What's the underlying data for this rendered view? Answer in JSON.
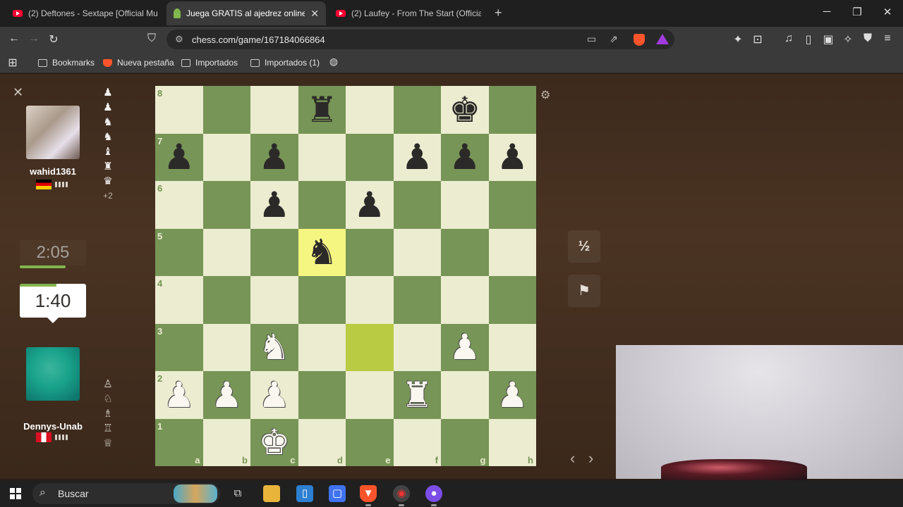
{
  "browser": {
    "tabs": [
      {
        "title": "(2) Deftones - Sextape [Official Music",
        "icon": "youtube-icon",
        "active": false
      },
      {
        "title": "Juega GRATIS al ajedrez online -",
        "icon": "chess-pawn-icon",
        "active": true
      },
      {
        "title": "(2) Laufey - From The Start (Official M",
        "icon": "youtube-icon",
        "active": false
      }
    ],
    "url": "chess.com/game/167184066864",
    "bookmarks": [
      {
        "label": "Bookmarks",
        "icon": "bookmarks-icon"
      },
      {
        "label": "Nueva pestaña",
        "icon": "brave-icon"
      },
      {
        "label": "Importados",
        "icon": "folder-icon"
      },
      {
        "label": "Importados (1)",
        "icon": "folder-icon"
      }
    ]
  },
  "game": {
    "top_player": {
      "name": "wahid1361",
      "country": "Germany",
      "clock": "2:05",
      "captured": [
        "♟",
        "♟",
        "♞",
        "♞",
        "♝",
        "♜",
        "♛"
      ],
      "material_diff": "+2"
    },
    "bottom_player": {
      "name": "Dennys-Unab",
      "country": "Peru",
      "clock": "1:40",
      "captured": [
        "♙",
        "♘",
        "♗",
        "♖",
        "♕"
      ]
    },
    "board": {
      "orientation": "white",
      "ranks": [
        "8",
        "7",
        "6",
        "5",
        "4",
        "3",
        "2",
        "1"
      ],
      "files": [
        "a",
        "b",
        "c",
        "d",
        "e",
        "f",
        "g",
        "h"
      ],
      "position": [
        [
          "",
          "",
          "",
          "r",
          "",
          "",
          "k",
          ""
        ],
        [
          "p",
          "",
          "p",
          "",
          "",
          "p",
          "p",
          "p"
        ],
        [
          "",
          "",
          "p",
          "",
          "p",
          "",
          "",
          ""
        ],
        [
          "",
          "",
          "",
          "n",
          "",
          "",
          "",
          ""
        ],
        [
          "",
          "",
          "",
          "",
          "",
          "",
          "",
          ""
        ],
        [
          "",
          "",
          "N",
          "",
          "",
          "",
          "P",
          ""
        ],
        [
          "P",
          "P",
          "P",
          "",
          "",
          "R",
          "",
          "P"
        ],
        [
          "",
          "",
          "K",
          "",
          "",
          "",
          "",
          ""
        ]
      ],
      "highlighted_squares": [
        "d5",
        "e3"
      ],
      "colors": {
        "light": "#ebecd0",
        "dark": "#779556",
        "highlight_light": "#f5f682",
        "highlight_dark": "#b9ca43"
      }
    },
    "controls": {
      "draw_label": "½",
      "resign_icon": "flag-icon",
      "settings_icon": "gear-icon",
      "prev_icon": "chevron-left-icon",
      "next_icon": "chevron-right-icon"
    }
  },
  "taskbar": {
    "search_placeholder": "Buscar"
  }
}
